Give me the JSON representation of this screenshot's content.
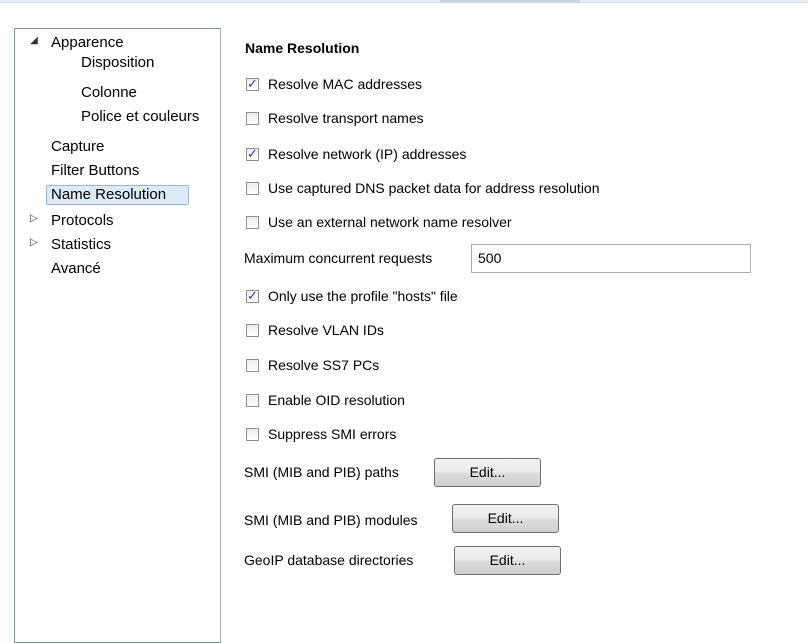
{
  "tree": {
    "items": [
      {
        "label": "Apparence",
        "expanded": true
      },
      {
        "label": "Disposition"
      },
      {
        "label": "Colonne"
      },
      {
        "label": "Police et couleurs"
      },
      {
        "label": "Capture"
      },
      {
        "label": "Filter Buttons"
      },
      {
        "label": "Name Resolution",
        "selected": true
      },
      {
        "label": "Protocols",
        "collapsed": true
      },
      {
        "label": "Statistics",
        "collapsed": true
      },
      {
        "label": "Avancé"
      }
    ]
  },
  "main": {
    "title": "Name Resolution",
    "checkboxes": [
      {
        "label": "Resolve MAC addresses",
        "checked": true
      },
      {
        "label": "Resolve transport names",
        "checked": false
      },
      {
        "label": "Resolve network (IP) addresses",
        "checked": true
      },
      {
        "label": "Use captured DNS packet data for address resolution",
        "checked": false
      },
      {
        "label": "Use an external network name resolver",
        "checked": false
      },
      {
        "label": "Only use the profile \"hosts\" file",
        "checked": true
      },
      {
        "label": "Resolve VLAN IDs",
        "checked": false
      },
      {
        "label": "Resolve SS7 PCs",
        "checked": false
      },
      {
        "label": "Enable OID resolution",
        "checked": false
      },
      {
        "label": "Suppress SMI errors",
        "checked": false
      }
    ],
    "max_requests": {
      "label": "Maximum concurrent requests",
      "value": "500"
    },
    "paths": [
      {
        "label": "SMI (MIB and PIB) paths",
        "button": "Edit..."
      },
      {
        "label": "SMI (MIB and PIB) modules",
        "button": "Edit..."
      },
      {
        "label": "GeoIP database directories",
        "button": "Edit..."
      }
    ]
  }
}
